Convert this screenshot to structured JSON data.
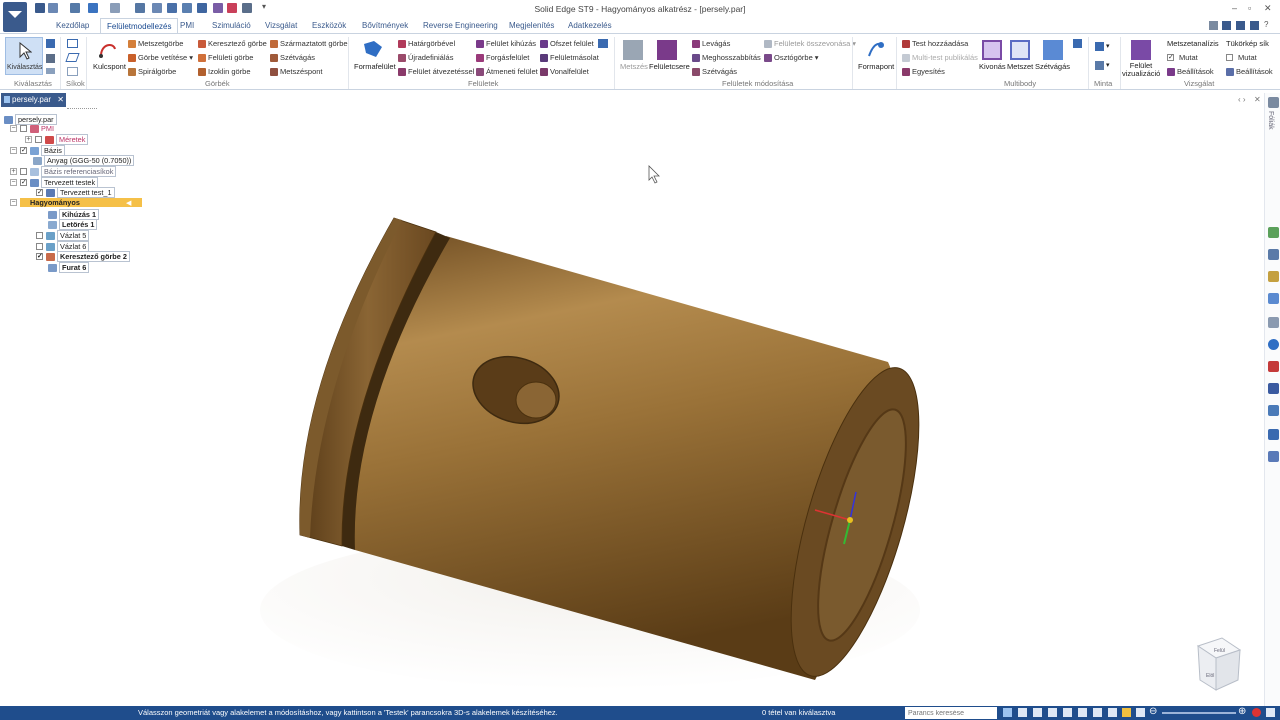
{
  "window": {
    "title": "Solid Edge ST9 - Hagyományos alkatrész - [persely.par]"
  },
  "tabs": [
    "Kezdőlap",
    "Felületmodellezés",
    "PMI",
    "Szimuláció",
    "Vizsgálat",
    "Eszközök",
    "Bővítmények",
    "Reverse Engineering",
    "Megjelenítés",
    "Adatkezelés"
  ],
  "ribbon": {
    "select": {
      "label": "Kiválasztás",
      "group": "Kiválasztás"
    },
    "sikok": {
      "group": "Síkok"
    },
    "gorbek": {
      "kulcspont": "Kulcspont",
      "items": [
        "Metszetgörbe",
        "Görbe vetítése",
        "Spirálgörbe",
        "Keresztező görbe",
        "Felületi görbe",
        "Izoklin görbe",
        "Származtatott görbe",
        "Szétvágás",
        "Metszéspont"
      ],
      "group": "Görbék"
    },
    "feluletek": {
      "formafelulet": "Formafelület",
      "items": [
        "Határgörbével",
        "Újradefiniálás",
        "Felület átvezetéssel",
        "Felület kihúzás",
        "Forgásfelület",
        "Átmeneti felület",
        "Ofszet felület",
        "Felületmásolat",
        "Vonalfelület"
      ],
      "group": "Felületek"
    },
    "modositas": {
      "metszes": "Metszés",
      "feluletcsere": "Felületcsere",
      "items": [
        "Levágás",
        "Meghosszabbítás",
        "Szétvágás",
        "Felületek összevonása",
        "Osztógörbe"
      ],
      "group": "Felületek módosítása"
    },
    "formapont": "Formapont",
    "multibody": {
      "items": [
        "Test hozzáadása",
        "Multi-test publikálás",
        "Egyesítés"
      ],
      "kivonas": "Kivonás",
      "metszet": "Metszet",
      "szetvagas": "Szétvágás",
      "group": "Multibody"
    },
    "minta": {
      "group": "Minta"
    },
    "vizsgalat": {
      "vizualizacio": "Felület vizualizáció",
      "metszetanalizis": "Metszetanalízis",
      "mutat1": "Mutat",
      "beallitasok1": "Beállítások",
      "tukorkep": "Tükörkép sík",
      "mutat2": "Mutat",
      "beallitasok2": "Beállítások",
      "group": "Vizsgálat"
    }
  },
  "doc_tab": "persely.par",
  "tree": {
    "root": "persely.par",
    "pmi": "PMI",
    "meretek": "Méretek",
    "bazis": "Bázis",
    "anyag": "Anyag (GGG-50  (0.7050))",
    "bazis_ref": "Bázis referenciasíkok",
    "tervezett_testek": "Tervezett testek",
    "tervezett_test": "Tervezett test_1",
    "hagyomanyos": "Hagyományos",
    "features": [
      "Kihúzás 1",
      "Letörés 1",
      "Vázlat 5",
      "Vázlat 6",
      "Keresztező görbe 2",
      "Furat 6"
    ]
  },
  "viewcube": {
    "top": "Felül",
    "front": "Elöl"
  },
  "right_panel_label": "Fóliák",
  "status": {
    "prompt": "Válasszon geometriát vagy alakelemet a módosításhoz, vagy kattintson a 'Testek' parancsokra 3D-s alakelemek készítéséhez.",
    "selection": "0 tétel van kiválasztva",
    "search_placeholder": "Parancs keresése"
  },
  "colors": {
    "accent": "#3a5a8c",
    "status_bar": "#1f4d8c",
    "highlight": "#f5c048",
    "bronze": "#8a6534"
  }
}
